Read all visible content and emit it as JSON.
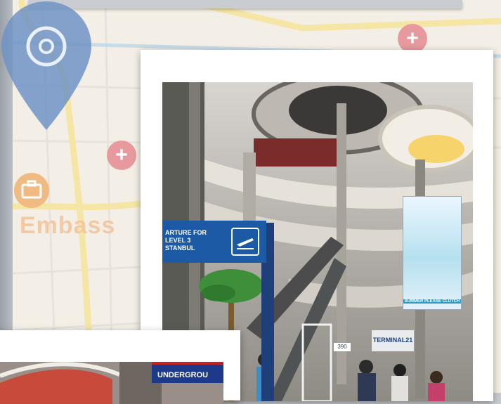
{
  "map": {
    "label": "Embass",
    "icons": [
      "location-pin-icon",
      "hospital-icon",
      "suitcase-icon"
    ],
    "colors": {
      "background": "#f4efe6",
      "road": "#f6e7a8",
      "pin": "#6f93c4"
    }
  },
  "photo_main": {
    "departure_sign": {
      "lines": [
        "ARTURE FOR",
        "LEVEL 3",
        "STANBUL"
      ],
      "icon": "airplane-departure-icon"
    },
    "banner": {
      "title": "",
      "footer": "SUMMER PLEASE CLUTCH"
    },
    "store_sign": "TERMINAL21",
    "price_tag": "390"
  },
  "photo_bottom": {
    "sign": "UNDERGROU"
  }
}
